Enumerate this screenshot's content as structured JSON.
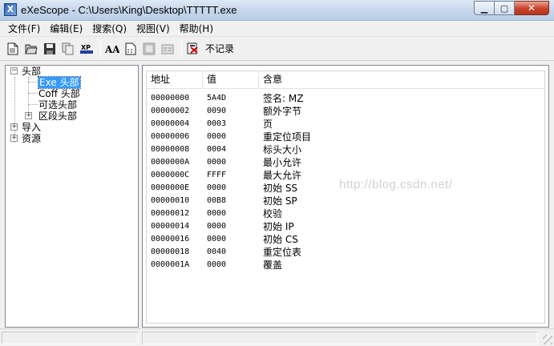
{
  "window": {
    "icon_glyph": "X",
    "title": "eXeScope - C:\\Users\\King\\Desktop\\TTTTT.exe",
    "minimize_glyph": "▁",
    "maximize_glyph": "▢",
    "close_glyph": "✕"
  },
  "menu": {
    "items": [
      "文件(F)",
      "编辑(E)",
      "搜索(Q)",
      "视图(V)",
      "帮助(H)"
    ]
  },
  "toolbar": {
    "no_record_label": "不记录",
    "buttons": [
      "new-icon",
      "open-icon",
      "save-icon",
      "copy-icon",
      "xp-icon",
      "font-icon",
      "dump-icon",
      "export-icon",
      "import-icon",
      "record-icon"
    ],
    "xp_label": "XP",
    "font_label": "AA"
  },
  "tree": {
    "root_header": "头部",
    "exe_header": "Exe 头部",
    "coff_header": "Coff 头部",
    "optional_header": "可选头部",
    "section_header": "区段头部",
    "import": "导入",
    "resource": "资源",
    "expanded_glyph": "−",
    "collapsed_glyph": "+"
  },
  "list": {
    "columns": [
      "地址",
      "值",
      "含意"
    ],
    "rows": [
      [
        "00000000",
        "5A4D",
        "签名: MZ"
      ],
      [
        "00000002",
        "0090",
        "额外字节"
      ],
      [
        "00000004",
        "0003",
        "页"
      ],
      [
        "00000006",
        "0000",
        "重定位项目"
      ],
      [
        "00000008",
        "0004",
        "标头大小"
      ],
      [
        "0000000A",
        "0000",
        "最小允许"
      ],
      [
        "0000000C",
        "FFFF",
        "最大允许"
      ],
      [
        "0000000E",
        "0000",
        "初始 SS"
      ],
      [
        "00000010",
        "00B8",
        "初始 SP"
      ],
      [
        "00000012",
        "0000",
        "校验"
      ],
      [
        "00000014",
        "0000",
        "初始 IP"
      ],
      [
        "00000016",
        "0000",
        "初始 CS"
      ],
      [
        "00000018",
        "0040",
        "重定位表"
      ],
      [
        "0000001A",
        "0000",
        "覆盖"
      ]
    ]
  },
  "watermark": "http://blog.csdn.net/"
}
